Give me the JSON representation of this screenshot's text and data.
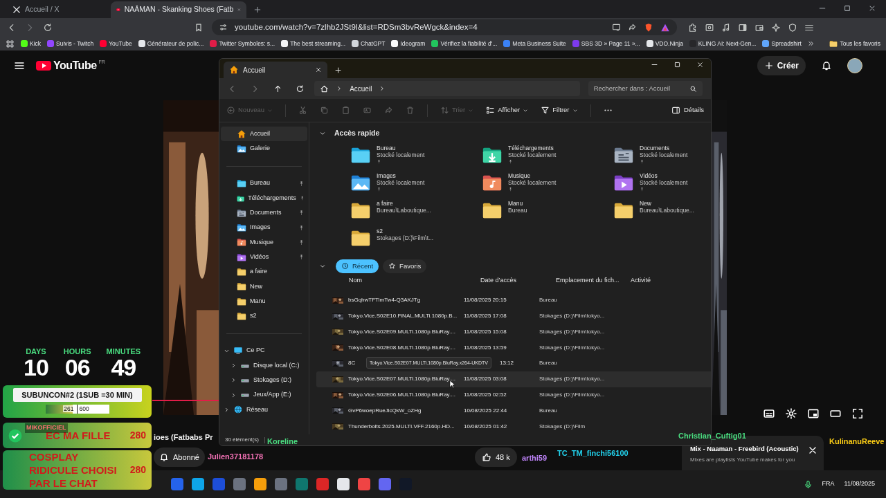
{
  "browser": {
    "tabs": [
      {
        "title": "Accueil / X",
        "kind": "x",
        "selected": false
      },
      {
        "title": "NAÂMAN - Skanking Shoes (Fatb",
        "kind": "youtube",
        "selected": true
      }
    ],
    "url": "youtube.com/watch?v=7zlhb2JSt9I&list=RDSm3bvReWgck&index=4",
    "bookmarks": [
      {
        "label": "Kick",
        "color": "#53fc18"
      },
      {
        "label": "Suivis - Twitch",
        "color": "#9146ff"
      },
      {
        "label": "YouTube",
        "color": "#ff0033"
      },
      {
        "label": "Générateur de polic...",
        "color": "#e5e7eb"
      },
      {
        "label": "Twitter Symboles: s...",
        "color": "#e11d48"
      },
      {
        "label": "The best streaming...",
        "color": "#f3f4f6"
      },
      {
        "label": "ChatGPT",
        "color": "#d1d5db"
      },
      {
        "label": "Ideogram",
        "color": "#f9fafb"
      },
      {
        "label": "Vérifiez la fiabilité d'...",
        "color": "#22c55e"
      },
      {
        "label": "Meta Business Suite",
        "color": "#3b82f6"
      },
      {
        "label": "SBS 3D » Page 11 »...",
        "color": "#7c3aed"
      },
      {
        "label": "VDO.Ninja",
        "color": "#e5e7eb"
      },
      {
        "label": "KLING AI: Next-Gen...",
        "color": "#27272a"
      },
      {
        "label": "Spreadshirt",
        "color": "#60a5fa"
      }
    ],
    "all_bookmarks": "Tous les favoris"
  },
  "youtube": {
    "logo": "YouTube",
    "region": "FR",
    "create": "Créer",
    "video_title_fragment": "ioes (Fatbabs Pr",
    "subscribe": "Abonné",
    "likes": "48 k",
    "mix": {
      "title": "Mix - Naaman - Freebird (Acoustic)",
      "subtitle": "Mixes are playlists YouTube makes for you"
    }
  },
  "explorer": {
    "tab": "Accueil",
    "breadcrumb": "Accueil",
    "search": {
      "placeholder": "Rechercher dans : Accueil"
    },
    "commands": [
      {
        "label": "Nouveau",
        "kind": "new",
        "disabled": true
      },
      {
        "kind": "cut",
        "disabled": true
      },
      {
        "kind": "copy",
        "disabled": true
      },
      {
        "kind": "paste",
        "disabled": true
      },
      {
        "kind": "rename",
        "disabled": true
      },
      {
        "kind": "share",
        "disabled": true
      },
      {
        "kind": "delete",
        "disabled": true
      },
      {
        "label": "Trier",
        "kind": "sort",
        "disabled": true
      },
      {
        "label": "Afficher",
        "kind": "view",
        "disabled": false
      },
      {
        "label": "Filtrer",
        "kind": "filter",
        "disabled": false
      },
      {
        "kind": "more",
        "disabled": false
      }
    ],
    "details": "Détails",
    "sidebar": [
      {
        "label": "Accueil",
        "kind": "home",
        "selected": true
      },
      {
        "label": "Galerie",
        "kind": "images",
        "selected": false
      },
      {
        "kind": "divider"
      },
      {
        "label": "Bureau",
        "kind": "desktop",
        "pinned": true,
        "selected": false
      },
      {
        "label": "Téléchargements",
        "kind": "downloads",
        "pinned": true,
        "selected": false
      },
      {
        "label": "Documents",
        "kind": "documents",
        "pinned": true,
        "selected": false
      },
      {
        "label": "Images",
        "kind": "images",
        "pinned": true,
        "selected": false
      },
      {
        "label": "Musique",
        "kind": "music",
        "pinned": true,
        "selected": false
      },
      {
        "label": "Vidéos",
        "kind": "videos",
        "pinned": true,
        "selected": false
      },
      {
        "label": "a faire",
        "kind": "folder",
        "selected": false
      },
      {
        "label": "New",
        "kind": "folder",
        "selected": false
      },
      {
        "label": "Manu",
        "kind": "folder",
        "selected": false
      },
      {
        "label": "s2",
        "kind": "folder",
        "selected": false
      },
      {
        "kind": "divider"
      },
      {
        "label": "Ce PC",
        "kind": "pc",
        "expanded": true,
        "selected": false,
        "children": [
          {
            "label": "Disque local (C:)",
            "kind": "drive",
            "expanded": false,
            "selected": false
          },
          {
            "label": "Stokages (D:)",
            "kind": "drive",
            "expanded": false,
            "selected": false
          },
          {
            "label": "Jeux/App (E:)",
            "kind": "drive",
            "expanded": false,
            "selected": false
          }
        ]
      },
      {
        "label": "Réseau",
        "kind": "network",
        "expanded": false,
        "selected": false
      }
    ],
    "quick_access": {
      "title": "Accès rapide",
      "expanded": true,
      "items": [
        {
          "name": "Bureau",
          "location": "Stocké localement",
          "kind": "desktop",
          "pinned": true
        },
        {
          "name": "Téléchargements",
          "location": "Stocké localement",
          "kind": "downloads",
          "pinned": true
        },
        {
          "name": "Documents",
          "location": "Stocké localement",
          "kind": "documents",
          "pinned": true
        },
        {
          "name": "Images",
          "location": "Stocké localement",
          "kind": "images",
          "pinned": true
        },
        {
          "name": "Musique",
          "location": "Stocké localement",
          "kind": "music",
          "pinned": true
        },
        {
          "name": "Vidéos",
          "location": "Stocké localement",
          "kind": "videos",
          "pinned": true
        },
        {
          "name": "a faire",
          "location": "Bureau\\Laboutique...",
          "kind": "folder",
          "pinned": false
        },
        {
          "name": "Manu",
          "location": "Bureau",
          "kind": "folder",
          "pinned": false
        },
        {
          "name": "New",
          "location": "Bureau\\Laboutique...",
          "kind": "folder",
          "pinned": false
        },
        {
          "name": "s2",
          "location": "Stokages (D:)\\Film\\t...",
          "kind": "folder",
          "pinned": false
        }
      ]
    },
    "recent_tabs": [
      {
        "label": "Récent",
        "kind": "clock",
        "selected": true
      },
      {
        "label": "Favoris",
        "kind": "star",
        "selected": false
      }
    ],
    "columns": [
      "Nom",
      "Date d’accès",
      "Emplacement du fich...",
      "Activité"
    ],
    "rows": [
      {
        "name": "bsGqhwTFTimTw4-Q3AKJTg",
        "date": "11/08/2025 20:15",
        "location": "Bureau",
        "hovered": false
      },
      {
        "name": "Tokyo.Vice.S02E10.FiNAL.MULTi.1080p.B...",
        "date": "11/08/2025 17:08",
        "location": "Stokages (D:)\\Film\\tokyo...",
        "hovered": false
      },
      {
        "name": "Tokyo.Vice.S02E09.MULTi.1080p.BluRay....",
        "date": "11/08/2025 15:08",
        "location": "Stokages (D:)\\Film\\tokyo...",
        "hovered": false
      },
      {
        "name": "Tokyo.Vice.S02E08.MULTi.1080p.BluRay....",
        "date": "11/08/2025 13:59",
        "location": "Stokages (D:)\\Film\\tokyo...",
        "hovered": false
      },
      {
        "name": "8C",
        "date": "13:12",
        "location": "Bureau",
        "hovered": false
      },
      {
        "name": "Tokyo.Vice.S02E07.MULTi.1080p.BluRay....",
        "date": "11/08/2025 03:08",
        "location": "Stokages (D:)\\Film\\tokyo...",
        "hovered": true
      },
      {
        "name": "Tokyo.Vice.S02E06.MULTi.1080p.BluRay....",
        "date": "11/08/2025 02:52",
        "location": "Stokages (D:)\\Film\\tokyo...",
        "hovered": false
      },
      {
        "name": "GvP6woepRueJicQkW_oZHg",
        "date": "10/08/2025 22:44",
        "location": "Bureau",
        "hovered": false
      },
      {
        "name": "Thunderbolts.2025.MULTI.VFF.2160p.HD...",
        "date": "10/08/2025 01:42",
        "location": "Stokages (D:)\\Film",
        "hovered": false
      }
    ],
    "tooltip": "Tokyo.Vice.S02E07.MULTi.1080p.BluRay.x264-UKDTV",
    "status": "30 élément(s)"
  },
  "overlay": {
    "timer": [
      {
        "unit": "DAYS",
        "value": "10"
      },
      {
        "unit": "HOURS",
        "value": "06"
      },
      {
        "unit": "MINUTES",
        "value": "49"
      }
    ],
    "subathon": {
      "title": "SUBUNCON#2 (1SUB =30 MIN)",
      "current": "261",
      "goal": "600",
      "level": 0.43
    },
    "goals": [
      {
        "text": "EC MA FILLE",
        "cost": "280",
        "done": true,
        "user": "MIKOFFICIEL"
      },
      {
        "text": "COSPLAY RIDICULE CHOISI PAR LE CHAT",
        "cost": "280",
        "done": false
      }
    ],
    "chat_names": [
      {
        "name": "Koreline",
        "color": "#4ade80"
      },
      {
        "name": "Julien37181178",
        "color": "#f472b6"
      },
      {
        "name": "arthi59",
        "color": "#c084fc"
      },
      {
        "name": "TC_TM_finchi56100",
        "color": "#22d3ee"
      },
      {
        "name": "Christian_Cuftig01",
        "color": "#4ade80"
      },
      {
        "name": "KulinanuReeve",
        "color": "#facc15"
      }
    ]
  },
  "taskbar": {
    "language": "FRA",
    "date": "11/08/2025"
  }
}
